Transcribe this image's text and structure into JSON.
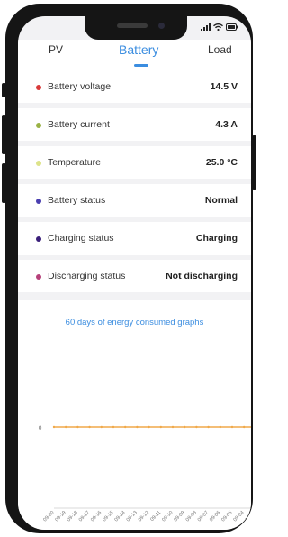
{
  "tabs": [
    {
      "label": "PV",
      "active": false
    },
    {
      "label": "Battery",
      "active": true
    },
    {
      "label": "Load",
      "active": false
    }
  ],
  "rows": [
    {
      "label": "Battery voltage",
      "value": "14.5 V",
      "dot_color": "#d83a3a"
    },
    {
      "label": "Battery current",
      "value": "4.3 A",
      "dot_color": "#9ab245"
    },
    {
      "label": "Temperature",
      "value": "25.0 °C",
      "dot_color": "#dde38a"
    },
    {
      "label": "Battery status",
      "value": "Normal",
      "dot_color": "#4a3fb0"
    },
    {
      "label": "Charging status",
      "value": "Charging",
      "dot_color": "#3a1f7a"
    },
    {
      "label": "Discharging status",
      "value": "Not discharging",
      "dot_color": "#b6417a"
    }
  ],
  "chart_title": "60 days of energy consumed graphs",
  "chart_data": {
    "type": "line",
    "ylabel": "",
    "xlabel": "",
    "y_tick_labels": [
      "0"
    ],
    "categories": [
      "09-20",
      "09-19",
      "09-18",
      "09-17",
      "09-16",
      "09-15",
      "09-14",
      "09-13",
      "09-12",
      "09-11",
      "09-10",
      "09-09",
      "09-08",
      "09-07",
      "09-06",
      "09-05",
      "09-04",
      "09-03"
    ],
    "series": [
      {
        "values": [
          0,
          0,
          0,
          0,
          0,
          0,
          0,
          0,
          0,
          0,
          0,
          0,
          0,
          0,
          0,
          0,
          0,
          0
        ],
        "color": "#f0a94a"
      }
    ],
    "grid": false
  },
  "colors": {
    "accent": "#3b8de0",
    "line": "#f0a94a"
  },
  "status_icons": [
    "signal-icon",
    "wifi-icon",
    "battery-icon"
  ]
}
